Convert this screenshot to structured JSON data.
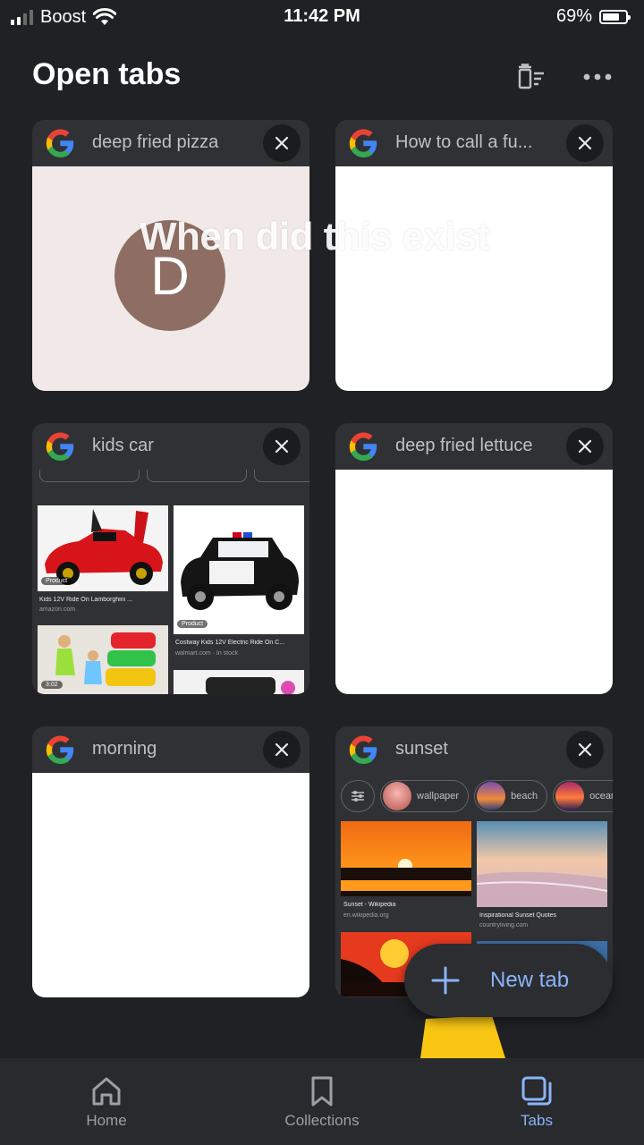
{
  "status_bar": {
    "carrier": "Boost",
    "time": "11:42 PM",
    "battery": "69%"
  },
  "header": {
    "title": "Open tabs",
    "clear_icon": "clear-all-tabs-icon",
    "more_icon": "more-options-icon"
  },
  "overlay_text": "When did this exist",
  "tabs": [
    {
      "title": "deep fried pizza",
      "preview": "avatar",
      "avatar_letter": "D"
    },
    {
      "title": "How to call a fu...",
      "preview": "blank"
    },
    {
      "title": "kids car",
      "preview": "image-results"
    },
    {
      "title": "deep fried lettuce",
      "preview": "blank"
    },
    {
      "title": "morning",
      "preview": "blank"
    },
    {
      "title": "sunset",
      "preview": "image-results"
    }
  ],
  "kids_car_results": {
    "items": [
      {
        "badge": "Product",
        "title": "Kids 12V Ride On Lamborghini ...",
        "source": "amazon.com"
      },
      {
        "badge": "Product",
        "title": "Costway Kids 12V Electric Ride On C...",
        "source": "walmart.com · In stock"
      },
      {
        "badge": "3:02"
      }
    ]
  },
  "sunset_results": {
    "chips": [
      "wallpaper",
      "beach",
      "ocean"
    ],
    "items": [
      {
        "title": "Sunset - Wikipedia",
        "source": "en.wikipedia.org"
      },
      {
        "title": "Inspirational Sunset Quotes",
        "source": "countryliving.com"
      }
    ]
  },
  "fab": {
    "label": "New tab"
  },
  "bottom_nav": [
    {
      "label": "Home",
      "icon": "home-icon"
    },
    {
      "label": "Collections",
      "icon": "bookmark-icon"
    },
    {
      "label": "Tabs",
      "icon": "tabs-icon",
      "active": true
    }
  ],
  "colors": {
    "background": "#202124",
    "accent": "#8ab4f8",
    "card": "#303134"
  }
}
